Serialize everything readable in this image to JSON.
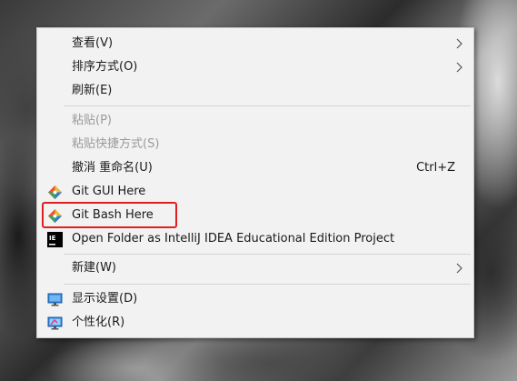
{
  "context_menu": {
    "items": [
      {
        "label": "查看(V)",
        "has_submenu": true
      },
      {
        "label": "排序方式(O)",
        "has_submenu": true
      },
      {
        "label": "刷新(E)"
      },
      {
        "label": "粘贴(P)",
        "disabled": true
      },
      {
        "label": "粘贴快捷方式(S)",
        "disabled": true
      },
      {
        "label": "撤消 重命名(U)",
        "shortcut": "Ctrl+Z"
      },
      {
        "label": "Git GUI Here",
        "icon": "git-gui-icon"
      },
      {
        "label": "Git Bash Here",
        "icon": "git-bash-icon",
        "highlighted": true
      },
      {
        "label": "Open Folder as IntelliJ IDEA Educational Edition Project",
        "icon": "intellij-idea-icon",
        "icon_text": "IE"
      },
      {
        "label": "新建(W)",
        "has_submenu": true
      },
      {
        "label": "显示设置(D)",
        "icon": "display-settings-icon"
      },
      {
        "label": "个性化(R)",
        "icon": "personalize-icon"
      }
    ]
  },
  "colors": {
    "menu_background": "#f2f2f2",
    "highlight_border": "#e02020",
    "disabled_text": "#9a9a9a"
  }
}
